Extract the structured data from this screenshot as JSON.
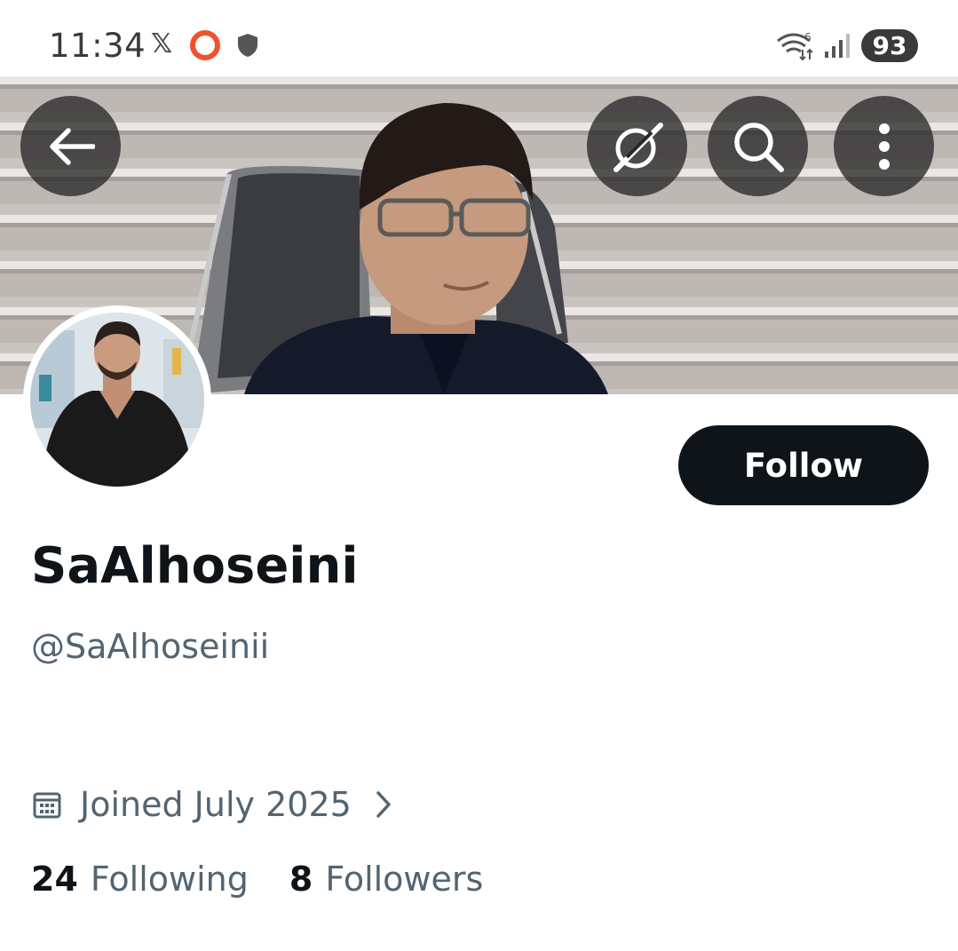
{
  "status_bar": {
    "time": "11:34",
    "battery": "93",
    "icons": [
      "x-logo-icon",
      "ring-icon",
      "shield-icon",
      "wifi-6-icon",
      "signal-icon"
    ]
  },
  "header": {
    "back_icon": "arrow-left-icon",
    "grok_icon": "grok-icon",
    "search_icon": "search-icon",
    "more_icon": "more-vertical-icon"
  },
  "profile": {
    "display_name": "SaAlhoseini",
    "handle": "@SaAlhoseinii",
    "joined": "Joined July 2025",
    "following_count": "24",
    "following_label": "Following",
    "followers_count": "8",
    "followers_label": "Followers"
  },
  "actions": {
    "follow_label": "Follow"
  },
  "colors": {
    "primary_text": "#0f1419",
    "secondary_text": "#536471",
    "button_bg": "#0f1419",
    "status_ring": "#f0522d"
  }
}
